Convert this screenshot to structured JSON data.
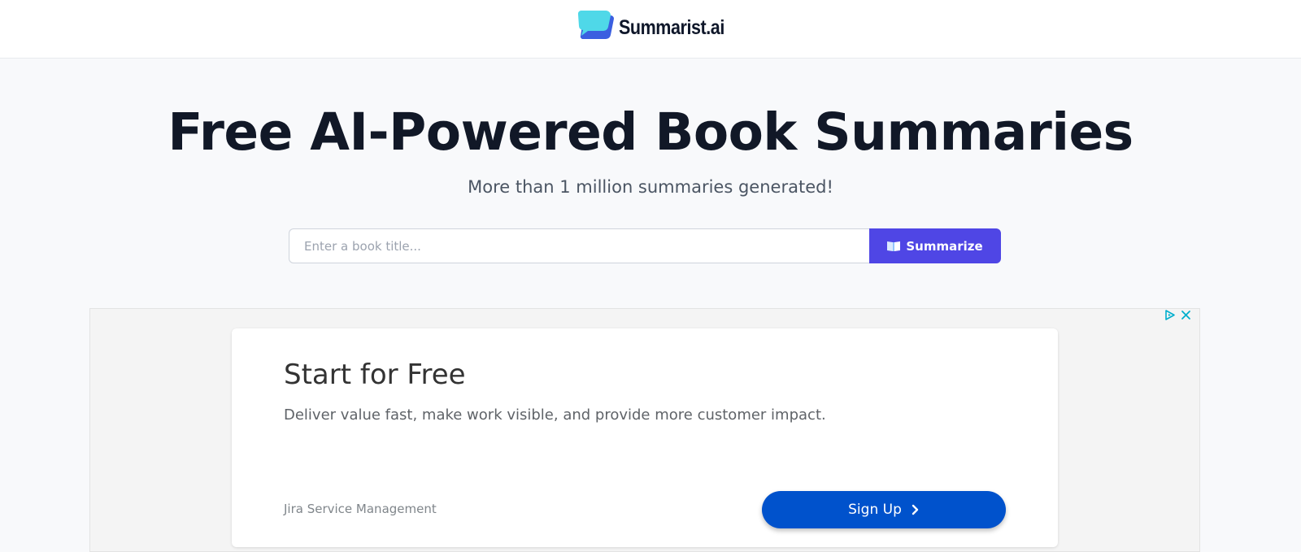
{
  "header": {
    "brand_name": "Summarist.ai",
    "logo_icon": "chat-bubble-logo-icon",
    "colors": {
      "logo_cyan": "#4fd8e8",
      "logo_blue": "#3b5fe0"
    }
  },
  "hero": {
    "title": "Free AI-Powered Book Summaries",
    "subtitle": "More than 1 million summaries generated!"
  },
  "search": {
    "placeholder": "Enter a book title...",
    "value": "",
    "button_label": "Summarize",
    "button_icon": "open-book-icon",
    "button_color": "#4f46e5"
  },
  "ad": {
    "choices_icons": [
      "adchoices-icon",
      "close-icon"
    ],
    "title": "Start for Free",
    "description": "Deliver value fast, make work visible, and provide more customer impact.",
    "advertiser": "Jira Service Management",
    "cta_label": "Sign Up",
    "cta_icon": "chevron-right-icon",
    "cta_color": "#0052cc"
  }
}
